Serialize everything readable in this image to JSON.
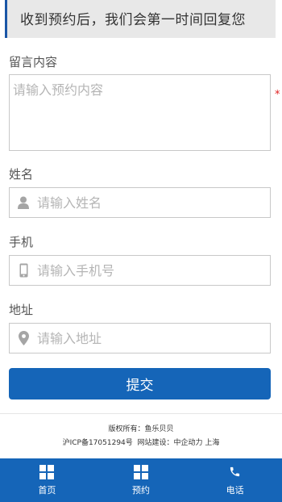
{
  "notice": {
    "text": "收到预约后，我们会第一时间回复您"
  },
  "form": {
    "message": {
      "label": "留言内容",
      "placeholder": "请输入预约内容",
      "required_mark": "*"
    },
    "name": {
      "label": "姓名",
      "placeholder": "请输入姓名",
      "icon": "user-icon"
    },
    "phone": {
      "label": "手机",
      "placeholder": "请输入手机号",
      "icon": "mobile-phone-icon"
    },
    "address": {
      "label": "地址",
      "placeholder": "请输入地址",
      "icon": "location-pin-icon"
    },
    "submit_label": "提交"
  },
  "footer": {
    "copyright": "版权所有：鱼乐贝贝",
    "icp": "沪ICP备17051294号",
    "builder": "网站建设：中企动力 上海"
  },
  "bottom_nav": {
    "items": [
      {
        "label": "首页",
        "icon": "grid-icon"
      },
      {
        "label": "预约",
        "icon": "grid-icon"
      },
      {
        "label": "电话",
        "icon": "phone-icon"
      }
    ]
  },
  "colors": {
    "accent": "#1565b8",
    "required": "#e02020",
    "notice_bg": "#e8e8e8"
  }
}
